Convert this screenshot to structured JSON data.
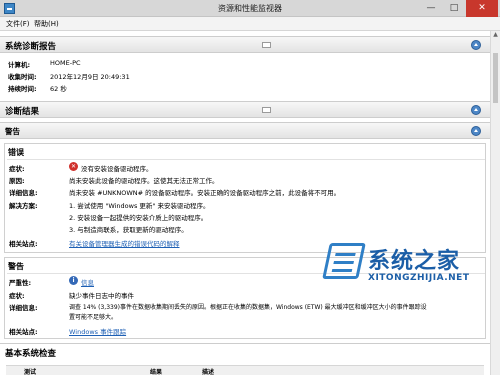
{
  "window": {
    "title": "资源和性能监视器",
    "controls": {
      "minimize": "—",
      "maximize": "□",
      "close": "✕"
    }
  },
  "menu": {
    "file": "文件(F)",
    "help": "帮助(H)"
  },
  "report": {
    "title": "系统诊断报告",
    "computer_label": "计算机:",
    "computer_value": "HOME-PC",
    "collected_label": "收集时间:",
    "collected_value": "2012年12月9日 20:49:31",
    "duration_label": "持续时间:",
    "duration_value": "62 秒"
  },
  "results": {
    "title": "诊断结果"
  },
  "warnings_section": {
    "title": "警告"
  },
  "error": {
    "title": "错误",
    "symptom_label": "症状:",
    "symptom_value": "没有安装设备驱动程序。",
    "cause_label": "原因:",
    "cause_value": "尚未安装此设备的驱动程序。这使其无法正常工作。",
    "details_label": "详细信息:",
    "details_value": "尚未安装 #UNKNOWN# 的设备驱动程序。安装正确的设备驱动程序之前，此设备将不可用。",
    "resolution_label": "解决方案:",
    "resolution_items": [
      "1. 尝试使用 \"Windows 更新\" 来安装驱动程序。",
      "2. 安装设备一起提供的安装介质上的驱动程序。",
      "3. 与制造商联系，获取更新的驱动程序。"
    ],
    "related_label": "相关站点:",
    "related_link": "有关设备管理器生成的错误代码的解释"
  },
  "warning": {
    "title": "警告",
    "severity_label": "严重性:",
    "severity_value": "信息",
    "symptom_label": "症状:",
    "symptom_value": "缺少事件日志中的事件",
    "details_label": "详细信息:",
    "details_line1": "调查 14% (3,339)事件在数据收集期间丢失的原因。根据正在收集的数据集，Windows (ETW) 最大缓冲区和缓冲区大小的事件跟踪设",
    "details_line2": "置可能不足够大。",
    "related_label": "相关站点:",
    "related_link": "Windows 事件跟踪"
  },
  "basic_checks": {
    "title": "基本系统检查",
    "columns": [
      "测试",
      "结果",
      "描述"
    ]
  },
  "watermark": {
    "cn": "系统之家",
    "en": "XITONGZHIJIA.NET"
  }
}
